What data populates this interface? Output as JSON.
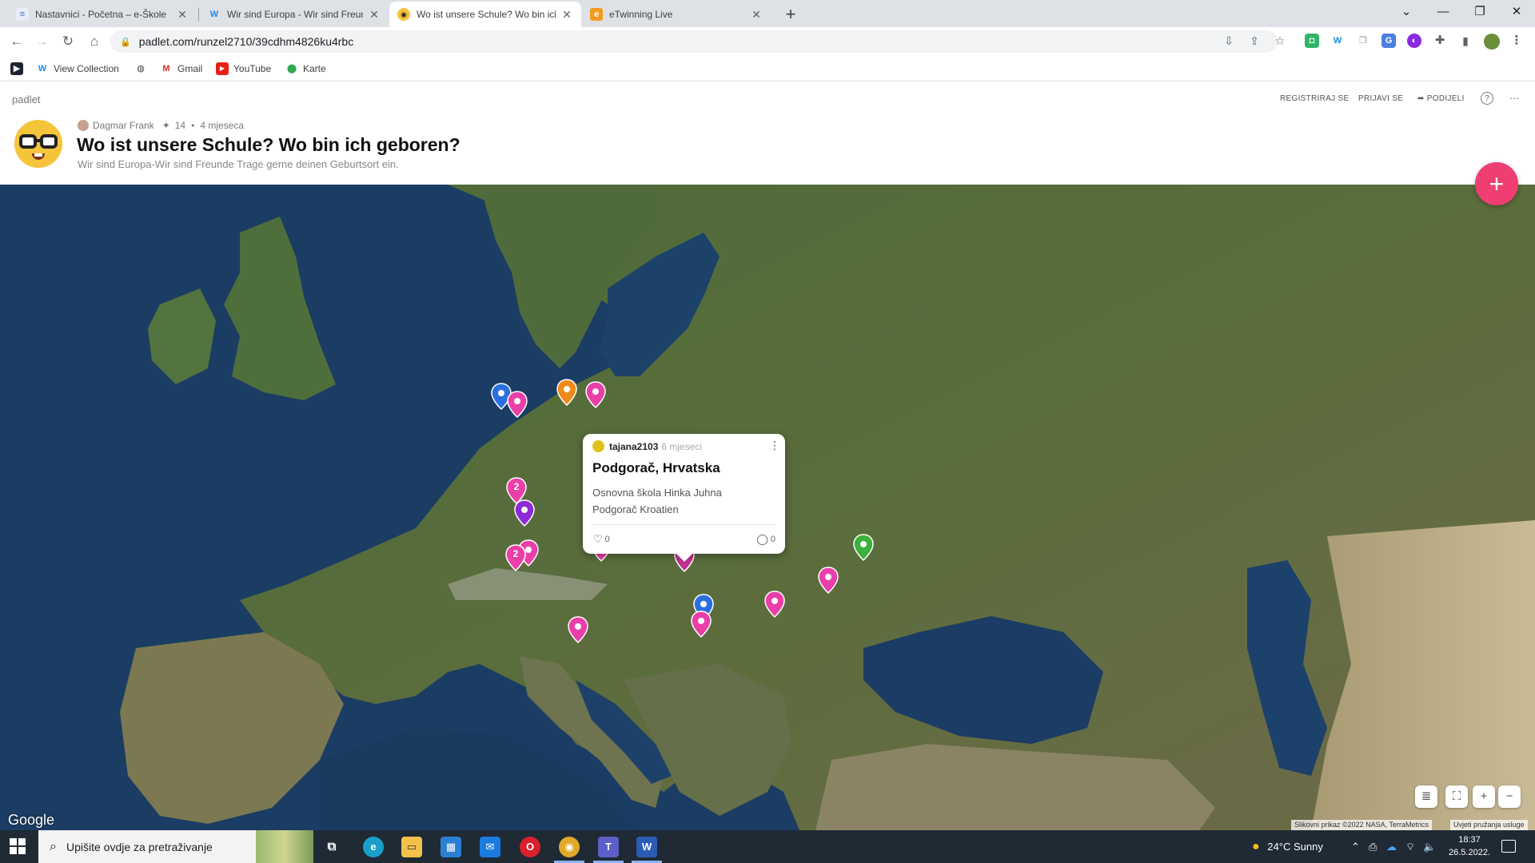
{
  "browser": {
    "tabs": [
      {
        "title": "Nastavnici - Početna – e-Škole",
        "active": false
      },
      {
        "title": "Wir sind Europa - Wir sind Freun",
        "active": false
      },
      {
        "title": "Wo ist unsere Schule? Wo bin ich",
        "active": true
      },
      {
        "title": "eTwinning Live",
        "active": false
      }
    ],
    "new_tab": "+",
    "url": "padlet.com/runzel2710/39cdhm4826ku4rbc",
    "bookmarks": [
      {
        "label": "",
        "icon": "bookmark-app-icon"
      },
      {
        "label": "View Collection",
        "icon": "w-icon"
      },
      {
        "label": "",
        "icon": "globe-icon"
      },
      {
        "label": "Gmail",
        "icon": "gmail-icon"
      },
      {
        "label": "YouTube",
        "icon": "youtube-icon"
      },
      {
        "label": "Karte",
        "icon": "maps-icon"
      }
    ]
  },
  "padlet": {
    "brand": "padlet",
    "actions": {
      "register": "REGISTRIRAJ SE",
      "login": "PRIJAVI SE",
      "share": "PODIJELI"
    },
    "author": "Dagmar Frank",
    "likes": "14",
    "age": "4 mjeseca",
    "title": "Wo ist unsere Schule? Wo bin ich geboren?",
    "subtitle": "Wir sind Europa-Wir sind Freunde Trage gerne deinen Geburtsort ein.",
    "add_button": "+"
  },
  "map": {
    "pins": [
      {
        "color": "#2a6fe0",
        "count": ""
      },
      {
        "color": "#ea3ea8",
        "count": ""
      },
      {
        "color": "#f08a1c",
        "count": ""
      },
      {
        "color": "#ea3ea8",
        "count": ""
      },
      {
        "color": "#ea3ea8",
        "count": "2"
      },
      {
        "color": "#8e2bd6",
        "count": ""
      },
      {
        "color": "#ea3ea8",
        "count": ""
      },
      {
        "color": "#ea3ea8",
        "count": "2"
      },
      {
        "color": "#ea3ea8",
        "count": ""
      },
      {
        "color": "#ea3ea8",
        "count": ""
      },
      {
        "color": "#c0328f",
        "count": ""
      },
      {
        "color": "#3bb03b",
        "count": ""
      },
      {
        "color": "#ea3ea8",
        "count": ""
      },
      {
        "color": "#ea3ea8",
        "count": ""
      },
      {
        "color": "#2a6fe0",
        "count": ""
      },
      {
        "color": "#ea3ea8",
        "count": ""
      },
      {
        "color": "#ea3ea8",
        "count": ""
      }
    ],
    "popup": {
      "user": "tajana2103",
      "time": "6 mjeseci",
      "title": "Podgorač, Hrvatska",
      "body_line1": "Osnovna škola Hinka Juhna",
      "body_line2": "Podgorač Kroatien",
      "likes": "0",
      "comments": "0"
    },
    "google": "Google",
    "attribution": "Slikovni prikaz ©2022 NASA, TerraMetrics",
    "terms": "Uvjeti pružanja usluge"
  },
  "taskbar": {
    "search_placeholder": "Upišite ovdje za pretraživanje",
    "weather": "24°C  Sunny",
    "time": "18:37",
    "date": "26.5.2022."
  }
}
